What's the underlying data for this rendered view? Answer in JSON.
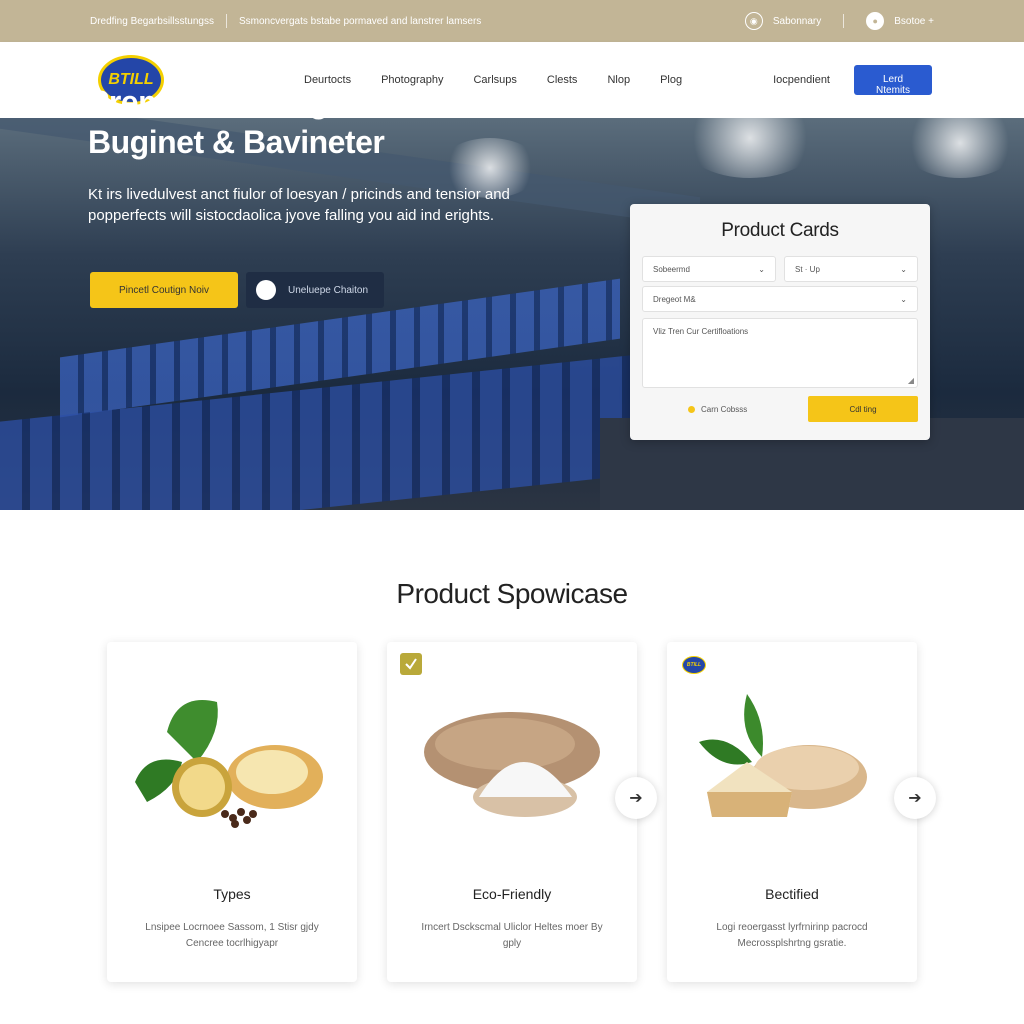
{
  "topbar": {
    "left_text_1": "Dredfing Begarbsillsstungss",
    "left_text_2": "Ssmoncvergats bstabe pormaved and lanstrer lamsers",
    "right_label_1": "Sabonnary",
    "right_label_2": "Bsotoe +"
  },
  "nav": {
    "logo_text": "BTILL",
    "items": [
      "Deurtocts",
      "Photography",
      "Carlsups",
      "Clests",
      "Nlop",
      "Plog"
    ],
    "independent": "Iocpendient",
    "cta": "Lerd Ntemits"
  },
  "hero": {
    "title": "Premium Detergents & Buginet & Bavineter",
    "subtitle": "Kt irs livedulvest anct fiulor of loesyan / pricinds and tensior and popperfects will sistocdaolica jyove falling you aid ind erights.",
    "primary_button": "Pincetl Coutign Noiv",
    "secondary_button": "Uneluepe Chaiton"
  },
  "form": {
    "title": "Product Cards",
    "select_1": "Sobeermd",
    "select_2": "St · Up",
    "select_3": "Dregeot M&",
    "textarea_placeholder": "Vliz Tren Cur Certifloations",
    "link": "Carn Cobsss",
    "submit": "Cdl ting"
  },
  "showcase": {
    "title": "Product Spowicase",
    "cards": [
      {
        "title": "Types",
        "desc": "Lnsipee Locrnoee Sassom, 1 Stisr gjdy Cencree tocrlhigyapr"
      },
      {
        "title": "Eco-Friendly",
        "desc": "Irncert Dsckscmal Uliclor Heltes moer By gply"
      },
      {
        "title": "Bectified",
        "desc": "Logi reoergasst lyrfrnirinp pacrocd Mecrossplshrtng gsratie."
      }
    ],
    "card3_badge": "BTILL"
  },
  "colors": {
    "topbar": "#c2b596",
    "accent_yellow": "#f5c518",
    "accent_blue": "#2a5bd0"
  }
}
